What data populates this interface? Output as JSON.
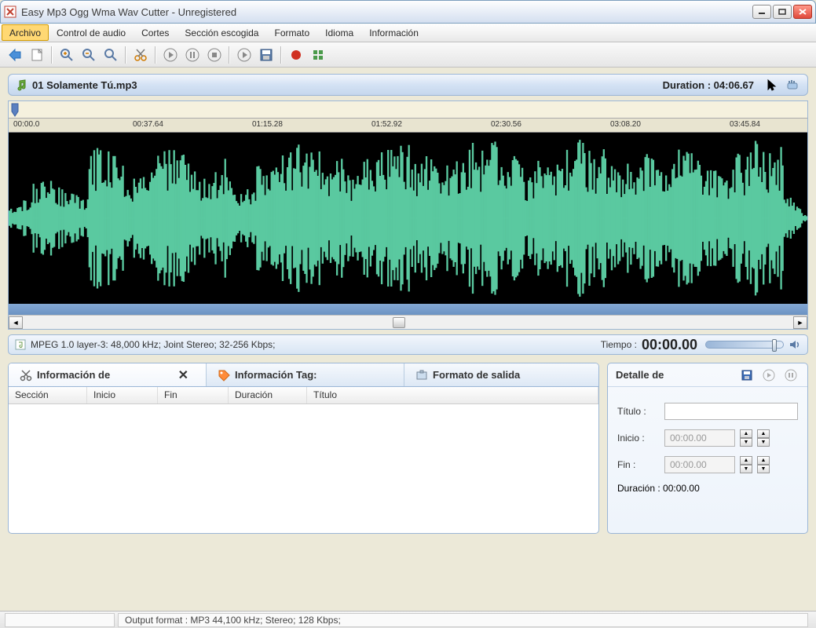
{
  "window": {
    "title": "Easy Mp3 Ogg Wma Wav Cutter - Unregistered"
  },
  "menu": {
    "items": [
      "Archivo",
      "Control de audio",
      "Cortes",
      "Sección escogida",
      "Formato",
      "Idioma",
      "Información"
    ],
    "active_index": 0
  },
  "file": {
    "name": "01 Solamente Tú.mp3",
    "duration_label": "Duration : ",
    "duration": "04:06.67"
  },
  "ruler": {
    "ticks": [
      "00:00.0",
      "00:37.64",
      "01:15.28",
      "01:52.92",
      "02:30.56",
      "03:08.20",
      "03:45.84"
    ]
  },
  "status": {
    "codec": "MPEG 1.0 layer-3: 48,000 kHz; Joint Stereo; 32-256 Kbps;",
    "tiempo_label": "Tiempo :",
    "tiempo": "00:00.00"
  },
  "tabs": {
    "seccion_info": "Información de",
    "tag_info": "Información Tag:",
    "formato_salida": "Formato de salida"
  },
  "table": {
    "headers": [
      "Sección",
      "Inicio",
      "Fin",
      "Duración",
      "Título"
    ]
  },
  "detail": {
    "title": "Detalle de",
    "titulo_label": "Título :",
    "titulo_value": "",
    "inicio_label": "Inicio :",
    "inicio_value": "00:00.00",
    "fin_label": "Fin :",
    "fin_value": "00:00.00",
    "duracion_label": "Duración : ",
    "duracion_value": "00:00.00"
  },
  "bottom": {
    "output_format": "Output format : MP3 44,100 kHz; Stereo;  128 Kbps;"
  }
}
